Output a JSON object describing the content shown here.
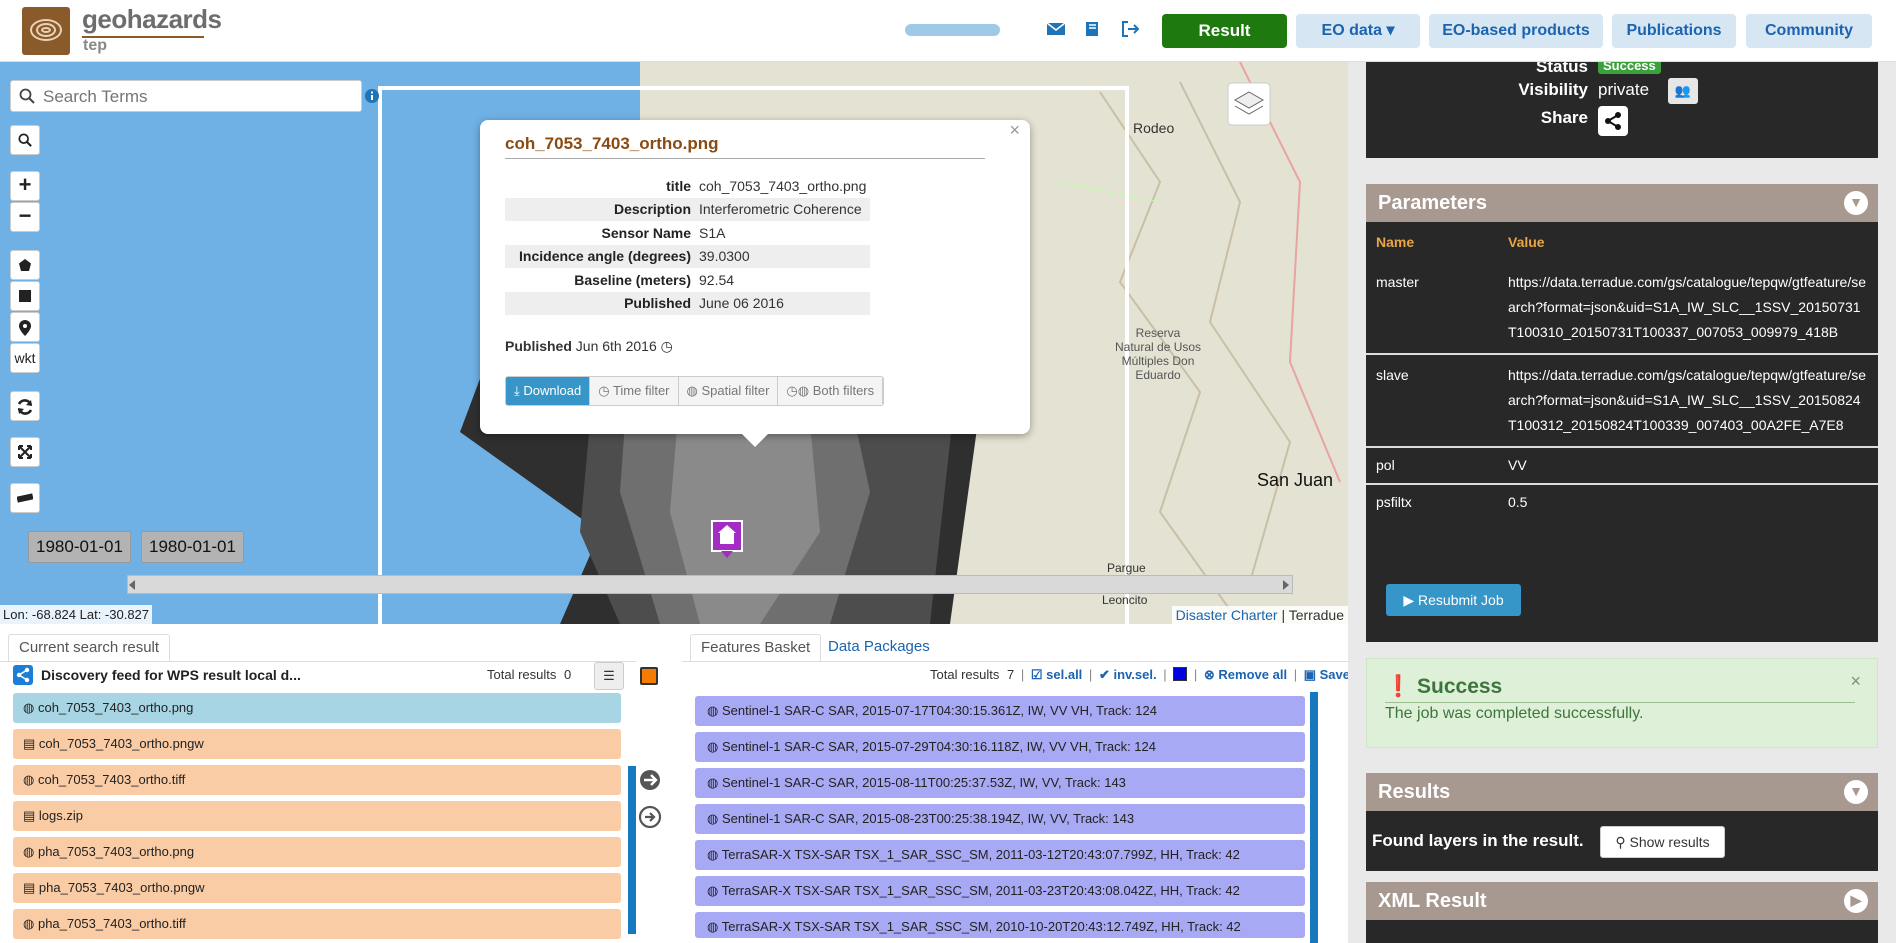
{
  "header": {
    "brand": "geohazards",
    "brand_sub": "tep",
    "nav": {
      "result": "Result",
      "eo_data": "EO data ▾",
      "eo_products": "EO-based products",
      "publications": "Publications",
      "community": "Community"
    }
  },
  "map": {
    "search_placeholder": "Search Terms",
    "wkt_label": "wkt",
    "date_start": "1980-01-01",
    "date_end": "1980-01-01",
    "coords": "Lon: -68.824 Lat: -30.827",
    "attrib_charter": "Disaster Charter",
    "attrib_terradue": "Terradue",
    "labels": {
      "rodeo": "Rodeo",
      "reserva": "Reserva\nNatural de Usos\nMúltiples Don\nEduardo",
      "sanjuan": "San Juan",
      "pargue": "Pargue",
      "leoncito": "Leoncito"
    }
  },
  "popup": {
    "title": "coh_7053_7403_ortho.png",
    "fields": [
      {
        "k": "title",
        "v": "coh_7053_7403_ortho.png"
      },
      {
        "k": "Description",
        "v": "Interferometric Coherence"
      },
      {
        "k": "Sensor Name",
        "v": "S1A"
      },
      {
        "k": "Incidence angle (degrees)",
        "v": "39.0300"
      },
      {
        "k": "Baseline (meters)",
        "v": "92.54"
      },
      {
        "k": "Published",
        "v": "June 06 2016"
      }
    ],
    "published_label": "Published",
    "published_value": "Jun 6th 2016",
    "buttons": {
      "download": "Download",
      "time": "Time filter",
      "spatial": "Spatial filter",
      "both": "Both filters"
    }
  },
  "left_panel": {
    "tab": "Current search result",
    "feed": "Discovery feed for WPS result local d...",
    "total_label": "Total results",
    "total_value": "0",
    "items": [
      "coh_7053_7403_ortho.png",
      "coh_7053_7403_ortho.pngw",
      "coh_7053_7403_ortho.tiff",
      "logs.zip",
      "pha_7053_7403_ortho.png",
      "pha_7053_7403_ortho.pngw",
      "pha_7053_7403_ortho.tiff"
    ]
  },
  "right_panel": {
    "tab_basket": "Features Basket",
    "tab_packages": "Data Packages",
    "total_label": "Total results",
    "total_value": "7",
    "sel_all": "sel.all",
    "inv_sel": "inv.sel.",
    "remove_all": "Remove all",
    "save": "Save",
    "items": [
      "Sentinel-1 SAR-C SAR, 2015-07-17T04:30:15.361Z, IW, VV VH, Track: 124",
      "Sentinel-1 SAR-C SAR, 2015-07-29T04:30:16.118Z, IW, VV VH, Track: 124",
      "Sentinel-1 SAR-C SAR, 2015-08-11T00:25:37.53Z, IW, VV, Track: 143",
      "Sentinel-1 SAR-C SAR, 2015-08-23T00:25:38.194Z, IW, VV, Track: 143",
      "TerraSAR-X TSX-SAR TSX_1_SAR_SSC_SM, 2011-03-12T20:43:07.799Z, HH, Track: 42",
      "TerraSAR-X TSX-SAR TSX_1_SAR_SSC_SM, 2011-03-23T20:43:08.042Z, HH, Track: 42",
      "TerraSAR-X TSX-SAR TSX_1_SAR_SSC_SM, 2010-10-20T20:43:12.749Z, HH, Track: 42"
    ]
  },
  "sidebar": {
    "status_label": "Status",
    "status_value": "Success",
    "visibility_label": "Visibility",
    "visibility_value": "private",
    "share_label": "Share",
    "parameters_title": "Parameters",
    "col_name": "Name",
    "col_value": "Value",
    "params": [
      {
        "name": "master",
        "value": "https://data.terradue.com/gs/catalogue/tepqw/gtfeature/search?format=json&uid=S1A_IW_SLC__1SSV_20150731T100310_20150731T100337_007053_009979_418B"
      },
      {
        "name": "slave",
        "value": "https://data.terradue.com/gs/catalogue/tepqw/gtfeature/search?format=json&uid=S1A_IW_SLC__1SSV_20150824T100312_20150824T100339_007403_00A2FE_A7E8"
      },
      {
        "name": "pol",
        "value": "VV"
      },
      {
        "name": "psfiltx",
        "value": "0.5"
      }
    ],
    "resubmit": "Resubmit Job",
    "success_title": "Success",
    "success_msg": "The job was completed successfully.",
    "results_title": "Results",
    "found_layers": "Found layers in the result.",
    "show_results": "Show results",
    "xml_title": "XML Result"
  },
  "colors": {
    "brand": "#8b5a2b",
    "result_btn": "#1e7a0f",
    "nav_pill": "#d6e7f3",
    "download": "#3596c7",
    "panel_head": "#a79890"
  }
}
